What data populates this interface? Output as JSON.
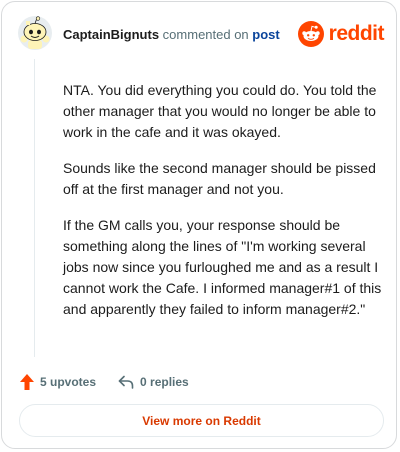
{
  "comment": {
    "username": "CaptainBignuts",
    "action_text": " commented on ",
    "post_link": "post",
    "paragraphs": [
      "NTA. You did everything you could do. You told the other manager that you would no longer be able to work in the cafe and it was okayed.",
      "Sounds like the second manager should be pissed off at the first manager and not you.",
      "If the GM calls you, your response should be something along the lines of \"I'm working several jobs now since you furloughed me and as a result I cannot work the Cafe. I informed manager#1 of this and apparently they failed to inform manager#2.\""
    ]
  },
  "logo": {
    "wordmark": "reddit",
    "icon": "reddit-alien-icon",
    "color": "#ff4500"
  },
  "actions": {
    "upvotes_label": "5 upvotes",
    "replies_label": "0 replies",
    "upvote_icon": "upvote-arrow-icon",
    "reply_icon": "reply-arrow-icon",
    "upvote_color": "#ff4500"
  },
  "view_more": {
    "label": "View more on Reddit",
    "color": "#d93900"
  }
}
